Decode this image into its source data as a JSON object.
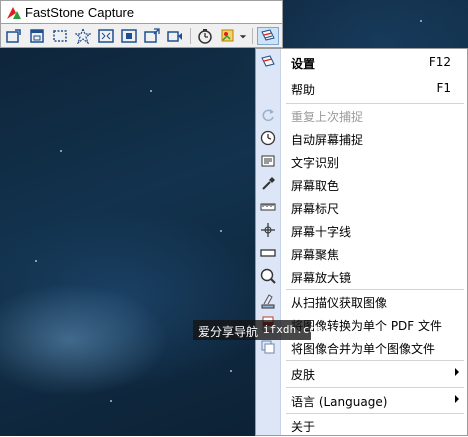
{
  "window": {
    "title": "FastStone Capture"
  },
  "toolbar": {
    "buttons": [
      {
        "name": "capture-active-window-icon"
      },
      {
        "name": "capture-window-object-icon"
      },
      {
        "name": "capture-rectangle-icon"
      },
      {
        "name": "capture-freehand-icon"
      },
      {
        "name": "capture-fullscreen-icon"
      },
      {
        "name": "capture-fixed-region-icon"
      },
      {
        "name": "capture-scrolling-icon"
      },
      {
        "name": "screen-recorder-icon"
      },
      {
        "name": "delay-timer-icon"
      },
      {
        "name": "output-destination-icon"
      },
      {
        "name": "settings-menu-icon"
      }
    ]
  },
  "menu": {
    "items": [
      {
        "label": "设置",
        "shortcut": "F12",
        "bold": true
      },
      {
        "label": "帮助",
        "shortcut": "F1"
      },
      {
        "label": "重复上次捕捉",
        "disabled": true
      },
      {
        "label": "自动屏幕捕捉"
      },
      {
        "label": "文字识别"
      },
      {
        "label": "屏幕取色"
      },
      {
        "label": "屏幕标尺"
      },
      {
        "label": "屏幕十字线"
      },
      {
        "label": "屏幕聚焦"
      },
      {
        "label": "屏幕放大镜"
      },
      {
        "label": "从扫描仪获取图像"
      },
      {
        "label": "将图像转换为单个 PDF 文件"
      },
      {
        "label": "将图像合并为单个图像文件"
      },
      {
        "label": "皮肤",
        "submenu": true
      },
      {
        "label": "语言 (Language)",
        "submenu": true
      },
      {
        "label": "关于"
      }
    ]
  },
  "watermark": {
    "text": "爱分享导航",
    "site": "ifxdh.com"
  },
  "colors": {
    "menu_strip": "#dde6f6",
    "desktop": "#12324d",
    "accent_red": "#e0201b",
    "accent_green": "#2e9b3a"
  }
}
